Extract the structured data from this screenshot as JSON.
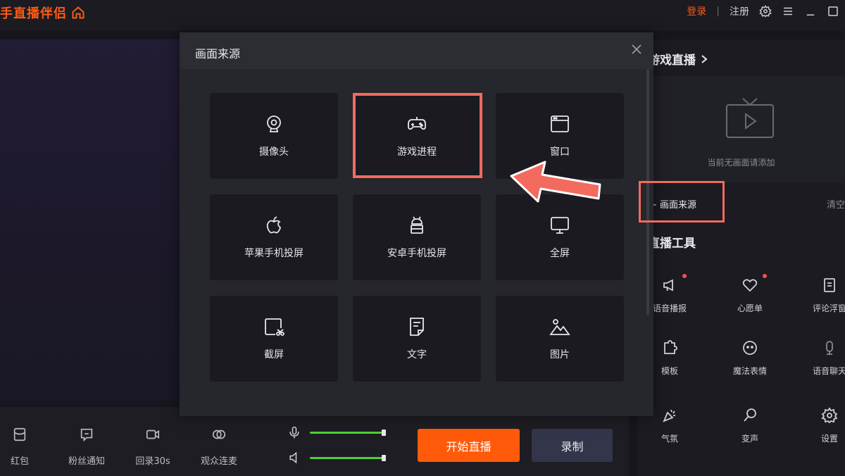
{
  "app": {
    "title": "手直播伴侣"
  },
  "topbar": {
    "login": "登录",
    "separator": "|",
    "register": "注册"
  },
  "modal": {
    "title": "画面来源",
    "tiles": [
      {
        "label": "摄像头",
        "icon": "camera-icon"
      },
      {
        "label": "游戏进程",
        "icon": "gamepad-icon"
      },
      {
        "label": "窗口",
        "icon": "window-icon"
      },
      {
        "label": "苹果手机投屏",
        "icon": "apple-icon"
      },
      {
        "label": "安卓手机投屏",
        "icon": "android-icon"
      },
      {
        "label": "全屏",
        "icon": "monitor-icon"
      },
      {
        "label": "截屏",
        "icon": "screenshot-icon"
      },
      {
        "label": "文字",
        "icon": "text-doc-icon"
      },
      {
        "label": "图片",
        "icon": "image-icon"
      }
    ]
  },
  "right_panel": {
    "scene_title": "游戏直播",
    "empty_text": "当前无画面请添加",
    "add_source": "+ 画面来源",
    "clear": "清空",
    "tools_title": "直播工具",
    "tools": [
      {
        "label": "语音播报",
        "icon": "megaphone-icon",
        "badge": true
      },
      {
        "label": "心愿单",
        "icon": "heart-icon",
        "badge": true
      },
      {
        "label": "评论浮窗",
        "icon": "comment-window-icon",
        "badge": false
      },
      {
        "label": "模板",
        "icon": "puzzle-icon",
        "badge": false
      },
      {
        "label": "魔法表情",
        "icon": "emoji-icon",
        "badge": false
      },
      {
        "label": "语音聊天",
        "icon": "voice-chat-icon",
        "badge": false
      },
      {
        "label": "气氛",
        "icon": "party-icon",
        "badge": false
      },
      {
        "label": "变声",
        "icon": "voice-change-icon",
        "badge": false
      },
      {
        "label": "设置",
        "icon": "settings-icon",
        "badge": false
      }
    ]
  },
  "bottombar": {
    "tools": [
      {
        "label": "红包",
        "icon": "red-packet-icon"
      },
      {
        "label": "粉丝通知",
        "icon": "fan-notify-icon"
      },
      {
        "label": "回录30s",
        "icon": "replay-icon"
      },
      {
        "label": "观众连麦",
        "icon": "co-host-icon"
      }
    ],
    "start_live": "开始直播",
    "record": "录制",
    "mic_volume": 1.0,
    "speaker_volume": 1.0
  },
  "colors": {
    "accent": "#ff5a14",
    "highlight": "#f26b5e",
    "slider": "#4cd137"
  }
}
